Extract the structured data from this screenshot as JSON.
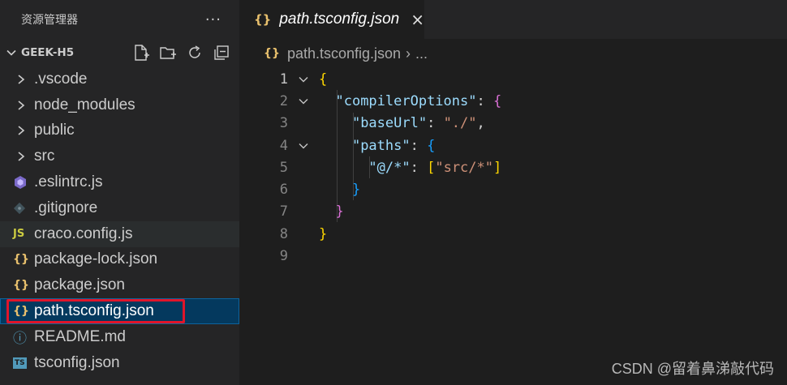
{
  "explorer": {
    "title": "资源管理器",
    "more": "···",
    "project": "GEEK-H5",
    "items": [
      {
        "type": "folder",
        "label": ".vscode"
      },
      {
        "type": "folder",
        "label": "node_modules"
      },
      {
        "type": "folder",
        "label": "public"
      },
      {
        "type": "folder",
        "label": "src"
      },
      {
        "type": "file",
        "label": ".eslintrc.js",
        "icon": "eslint-icon"
      },
      {
        "type": "file",
        "label": ".gitignore",
        "icon": "git-icon"
      },
      {
        "type": "file",
        "label": "craco.config.js",
        "icon": "js-icon",
        "icon_text": "JS"
      },
      {
        "type": "file",
        "label": "package-lock.json",
        "icon": "json-icon",
        "icon_text": "{}"
      },
      {
        "type": "file",
        "label": "package.json",
        "icon": "json-icon",
        "icon_text": "{}"
      },
      {
        "type": "file",
        "label": "path.tsconfig.json",
        "icon": "json-icon",
        "icon_text": "{}"
      },
      {
        "type": "file",
        "label": "README.md",
        "icon": "info-icon",
        "icon_text": "ⓘ"
      },
      {
        "type": "file",
        "label": "tsconfig.json",
        "icon": "ts-icon",
        "icon_text": "TS"
      }
    ]
  },
  "tab": {
    "title": "path.tsconfig.json",
    "icon_text": "{}",
    "close": "×"
  },
  "breadcrumb": {
    "file": "path.tsconfig.json",
    "sep": "›",
    "rest": "..."
  },
  "code": {
    "line_numbers": [
      "1",
      "2",
      "3",
      "4",
      "5",
      "6",
      "7",
      "8",
      "9"
    ],
    "lines": {
      "l1_open": "{",
      "l2_key": "\"compilerOptions\"",
      "l2_colon": ": ",
      "l2_open": "{",
      "l3_key": "\"baseUrl\"",
      "l3_colon": ": ",
      "l3_val": "\"./\"",
      "l3_comma": ",",
      "l4_key": "\"paths\"",
      "l4_colon": ": ",
      "l4_open": "{",
      "l5_key": "\"@/*\"",
      "l5_colon": ": ",
      "l5_open": "[",
      "l5_val": "\"src/*\"",
      "l5_close": "]",
      "l6_close": "}",
      "l7_close": "}",
      "l8_close": "}"
    }
  },
  "watermark": "CSDN @留着鼻涕敲代码",
  "colors": {
    "accent_highlight": "#e0152a",
    "selection": "#04395e",
    "json_icon": "#e8c06d"
  }
}
